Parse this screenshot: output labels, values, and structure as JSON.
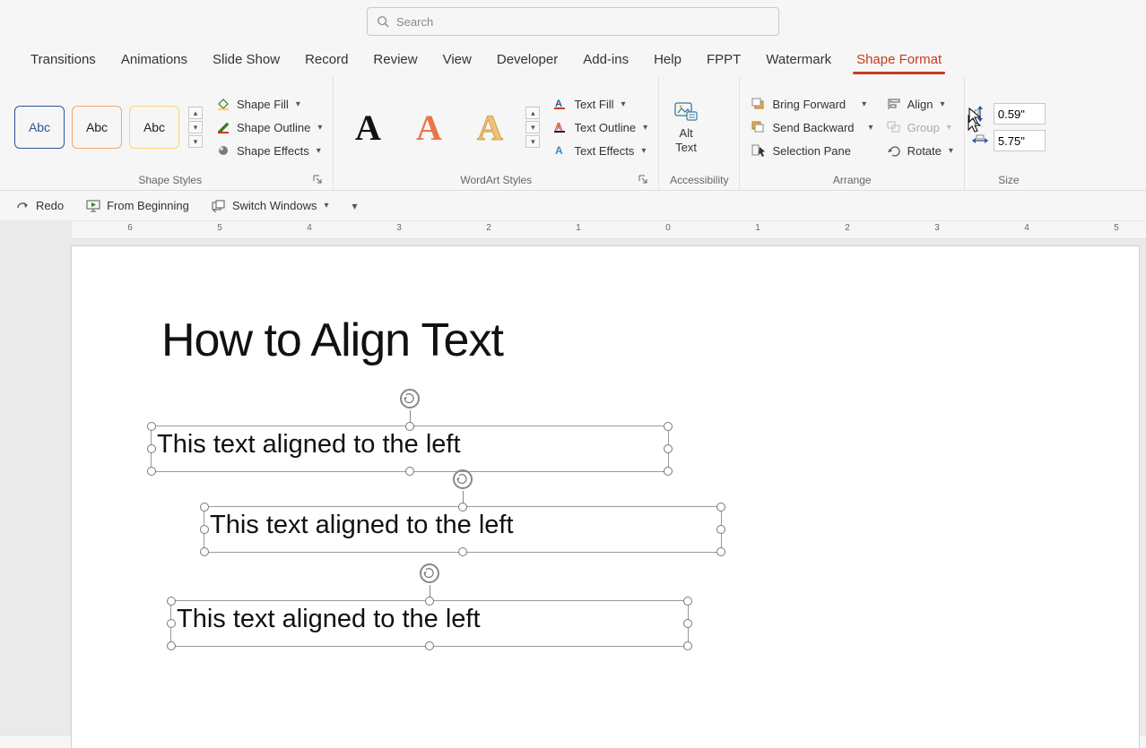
{
  "search": {
    "placeholder": "Search"
  },
  "tabs": {
    "transitions": "Transitions",
    "animations": "Animations",
    "slideshow": "Slide Show",
    "record": "Record",
    "review": "Review",
    "view": "View",
    "developer": "Developer",
    "addins": "Add-ins",
    "help": "Help",
    "fppt": "FPPT",
    "watermark": "Watermark",
    "shapeformat": "Shape Format"
  },
  "ribbon": {
    "shapeStyles": {
      "label": "Shape Styles",
      "thumb": "Abc",
      "fill": "Shape Fill",
      "outline": "Shape Outline",
      "effects": "Shape Effects"
    },
    "wordart": {
      "label": "WordArt Styles",
      "textfill": "Text Fill",
      "textoutline": "Text Outline",
      "texteffects": "Text Effects"
    },
    "accessibility": {
      "label": "Accessibility",
      "alt1": "Alt",
      "alt2": "Text"
    },
    "arrange": {
      "label": "Arrange",
      "forward": "Bring Forward",
      "backward": "Send Backward",
      "selpane": "Selection Pane",
      "align": "Align",
      "group": "Group",
      "rotate": "Rotate"
    },
    "size": {
      "label": "Size",
      "height": "0.59\"",
      "width": "5.75\""
    }
  },
  "qat": {
    "redo": "Redo",
    "begin": "From Beginning",
    "switch": "Switch Windows"
  },
  "ruler": {
    "nums": [
      "6",
      "5",
      "4",
      "3",
      "2",
      "1",
      "0",
      "1",
      "2",
      "3",
      "4",
      "5"
    ]
  },
  "slide": {
    "title": "How to Align Text",
    "tb1": "This text aligned to the left",
    "tb2": "This text aligned to the left",
    "tb3": "This text aligned to the left"
  }
}
